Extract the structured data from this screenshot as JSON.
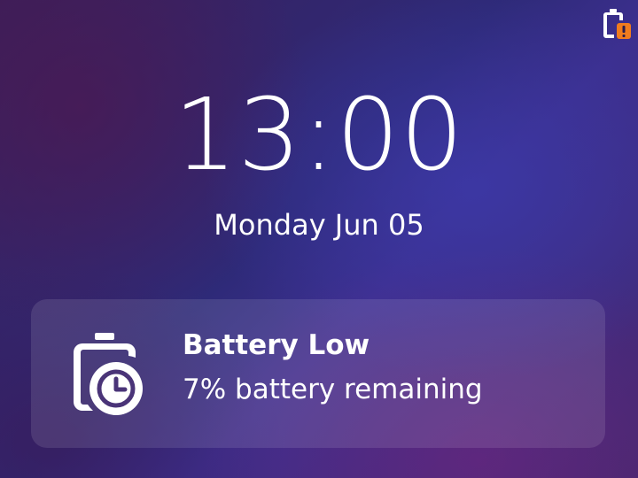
{
  "status_bar": {
    "battery_icon": "battery-low-warning-icon",
    "warning_color": "#f07b1e"
  },
  "lock_screen": {
    "time": "13:00",
    "date": "Monday Jun 05"
  },
  "notification": {
    "icon": "battery-clock-icon",
    "title": "Battery Low",
    "body": "7% battery remaining"
  }
}
